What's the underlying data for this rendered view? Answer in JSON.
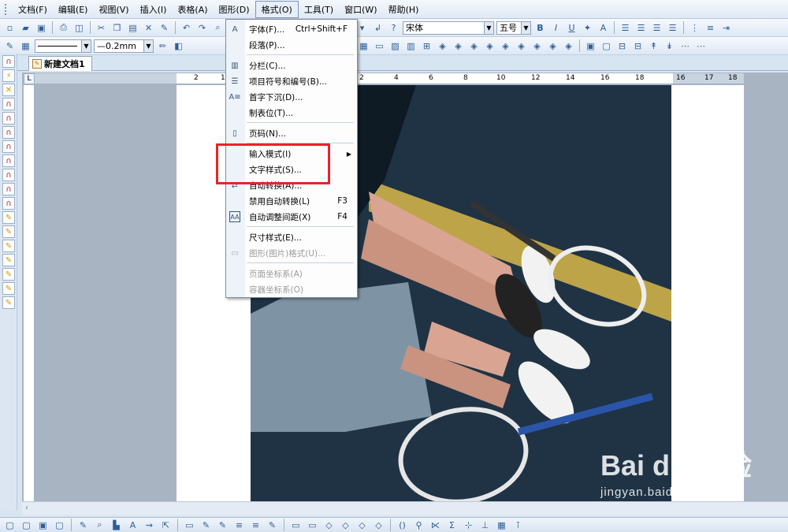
{
  "menubar": {
    "items": [
      "文档(F)",
      "编辑(E)",
      "视图(V)",
      "插入(I)",
      "表格(A)",
      "图形(D)",
      "格式(O)",
      "工具(T)",
      "窗口(W)",
      "帮助(H)"
    ],
    "active": "格式(O)"
  },
  "toolbar1": {
    "font_name": "宋体",
    "font_size": "五号",
    "bold": "B",
    "italic": "I",
    "underline": "U"
  },
  "toolbar2": {
    "line_width": "0.2mm"
  },
  "tab": {
    "document_name": "新建文档1"
  },
  "ruler": {
    "ticks": [
      "2",
      "1",
      "2",
      "4",
      "6",
      "8",
      "10",
      "12",
      "14",
      "16",
      "18",
      "16",
      "17",
      "18"
    ]
  },
  "format_menu": {
    "items": [
      {
        "label": "字体(F)...",
        "shortcut": "Ctrl+Shift+F",
        "icon": "font-icon"
      },
      {
        "label": "段落(P)...",
        "shortcut": "",
        "icon": ""
      },
      {
        "label": "分栏(C)...",
        "shortcut": "",
        "icon": "columns-icon"
      },
      {
        "label": "项目符号和编号(B)...",
        "shortcut": "",
        "icon": "bullets-icon"
      },
      {
        "label": "首字下沉(D)...",
        "shortcut": "",
        "icon": "dropcap-icon"
      },
      {
        "label": "制表位(T)...",
        "shortcut": "",
        "icon": ""
      },
      {
        "label": "页码(N)...",
        "shortcut": "",
        "icon": "page-number-icon"
      },
      {
        "label": "输入模式(I)",
        "shortcut": "",
        "icon": "",
        "submenu": true
      },
      {
        "label": "文字样式(S)...",
        "shortcut": "",
        "icon": ""
      },
      {
        "label": "自动转换(A)...",
        "shortcut": "",
        "icon": "auto-convert-icon"
      },
      {
        "label": "禁用自动转换(L)",
        "shortcut": "F3",
        "icon": ""
      },
      {
        "label": "自动调整间距(X)",
        "shortcut": "F4",
        "icon": "spacing-icon"
      },
      {
        "label": "尺寸样式(E)...",
        "shortcut": "",
        "icon": ""
      },
      {
        "label": "图形(图片)格式(U)...",
        "shortcut": "",
        "icon": "image-format-icon",
        "disabled": true
      },
      {
        "label": "页面坐标系(A)",
        "shortcut": "",
        "icon": "",
        "disabled": true
      },
      {
        "label": "容器坐标系(O)",
        "shortcut": "",
        "icon": "",
        "disabled": true
      }
    ]
  },
  "watermark": {
    "brand": "Bai du 经验",
    "url": "jingyan.baidu.com"
  },
  "colors": {
    "highlight_box": "#e8232b",
    "photo_background": "#1f3345"
  }
}
